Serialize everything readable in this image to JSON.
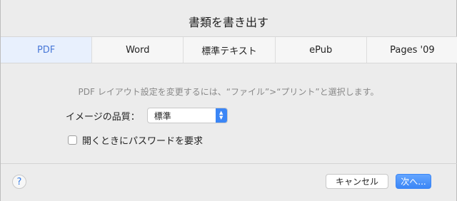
{
  "dialog": {
    "title": "書類を書き出す",
    "tabs": [
      {
        "label": "PDF",
        "active": true
      },
      {
        "label": "Word",
        "active": false
      },
      {
        "label": "標準テキスト",
        "active": false
      },
      {
        "label": "ePub",
        "active": false
      },
      {
        "label": "Pages '09",
        "active": false
      }
    ],
    "note": "PDF レイアウト設定を変更するには、“ファイル”>“プリント”と選択します。",
    "quality": {
      "label": "イメージの品質：",
      "value": "標準"
    },
    "password_checkbox": {
      "label": "開くときにパスワードを要求",
      "checked": false
    },
    "buttons": {
      "help": "?",
      "cancel": "キャンセル",
      "next": "次へ..."
    },
    "colors": {
      "active_tab_text": "#4a79d8",
      "accent": "#3b86f6"
    }
  }
}
